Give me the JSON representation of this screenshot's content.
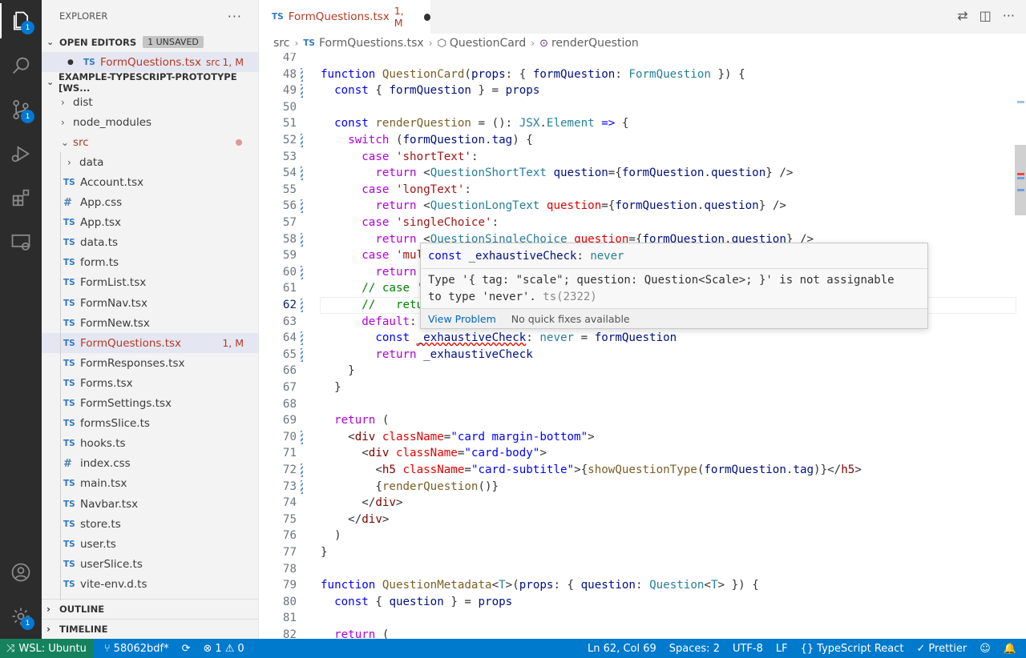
{
  "activity": {
    "explorer_badge": "1",
    "scm_badge": "1",
    "manage_badge": "1"
  },
  "sidebar": {
    "title": "EXPLORER",
    "more": "···",
    "open_editors": {
      "label": "OPEN EDITORS",
      "unsaved": "1 UNSAVED",
      "file": {
        "icon": "TS",
        "name": "FormQuestions.tsx",
        "dir": "src",
        "status": "1, M"
      }
    },
    "workspace": {
      "label": "EXAMPLE-TYPESCRIPT-PROTOTYPE [WS...",
      "items": [
        {
          "kind": "folder",
          "chev": "›",
          "name": "dist"
        },
        {
          "kind": "folder",
          "chev": "›",
          "name": "node_modules"
        },
        {
          "kind": "folder",
          "chev": "⌄",
          "name": "src"
        },
        {
          "kind": "folder",
          "chev": "›",
          "name": "data"
        },
        {
          "kind": "ts",
          "icon": "TS",
          "name": "Account.tsx"
        },
        {
          "kind": "css",
          "icon": "#",
          "name": "App.css"
        },
        {
          "kind": "ts",
          "icon": "TS",
          "name": "App.tsx"
        },
        {
          "kind": "ts",
          "icon": "TS",
          "name": "data.ts"
        },
        {
          "kind": "ts",
          "icon": "TS",
          "name": "form.ts"
        },
        {
          "kind": "ts",
          "icon": "TS",
          "name": "FormList.tsx"
        },
        {
          "kind": "ts",
          "icon": "TS",
          "name": "FormNav.tsx"
        },
        {
          "kind": "ts",
          "icon": "TS",
          "name": "FormNew.tsx"
        },
        {
          "kind": "ts",
          "icon": "TS",
          "name": "FormQuestions.tsx",
          "status": "1, M"
        },
        {
          "kind": "ts",
          "icon": "TS",
          "name": "FormResponses.tsx"
        },
        {
          "kind": "ts",
          "icon": "TS",
          "name": "Forms.tsx"
        },
        {
          "kind": "ts",
          "icon": "TS",
          "name": "FormSettings.tsx"
        },
        {
          "kind": "ts",
          "icon": "TS",
          "name": "formsSlice.ts"
        },
        {
          "kind": "ts",
          "icon": "TS",
          "name": "hooks.ts"
        },
        {
          "kind": "css",
          "icon": "#",
          "name": "index.css"
        },
        {
          "kind": "ts",
          "icon": "TS",
          "name": "main.tsx"
        },
        {
          "kind": "ts",
          "icon": "TS",
          "name": "Navbar.tsx"
        },
        {
          "kind": "ts",
          "icon": "TS",
          "name": "store.ts"
        },
        {
          "kind": "ts",
          "icon": "TS",
          "name": "user.ts"
        },
        {
          "kind": "ts",
          "icon": "TS",
          "name": "userSlice.ts"
        },
        {
          "kind": "ts",
          "icon": "TS",
          "name": "vite-env.d.ts"
        }
      ]
    },
    "outline": "OUTLINE",
    "timeline": "TIMELINE"
  },
  "tab": {
    "icon": "TS",
    "name": "FormQuestions.tsx",
    "status": "1, M"
  },
  "breadcrumb": {
    "folder": "src",
    "file_icon": "TS",
    "file": "FormQuestions.tsx",
    "component": "QuestionCard",
    "symbol": "renderQuestion"
  },
  "editor": {
    "current_line": 62,
    "lines": [
      {
        "n": "47"
      },
      {
        "n": "48"
      },
      {
        "n": "49"
      },
      {
        "n": "50"
      },
      {
        "n": "51"
      },
      {
        "n": "52"
      },
      {
        "n": "53"
      },
      {
        "n": "54"
      },
      {
        "n": "55"
      },
      {
        "n": "56"
      },
      {
        "n": "57"
      },
      {
        "n": "58"
      },
      {
        "n": "59"
      },
      {
        "n": "60"
      },
      {
        "n": "61"
      },
      {
        "n": "62"
      },
      {
        "n": "63"
      },
      {
        "n": "64"
      },
      {
        "n": "65"
      },
      {
        "n": "66"
      },
      {
        "n": "67"
      },
      {
        "n": "68"
      },
      {
        "n": "69"
      },
      {
        "n": "70"
      },
      {
        "n": "71"
      },
      {
        "n": "72"
      },
      {
        "n": "73"
      },
      {
        "n": "74"
      },
      {
        "n": "75"
      },
      {
        "n": "76"
      },
      {
        "n": "77"
      },
      {
        "n": "78"
      },
      {
        "n": "79"
      },
      {
        "n": "80"
      },
      {
        "n": "81"
      },
      {
        "n": "82"
      }
    ]
  },
  "hover": {
    "signature": "const _exhaustiveCheck: never",
    "message": "Type '{ tag: \"scale\"; question: Question<Scale>; }' is not assignable",
    "message2": "to type 'never'.",
    "code": "ts(2322)",
    "view_problem": "View Problem",
    "no_fixes": "No quick fixes available"
  },
  "status": {
    "remote": "WSL: Ubuntu",
    "branch": "58062bdf*",
    "errors": "1",
    "warnings": "0",
    "position": "Ln 62, Col 69",
    "spaces": "Spaces: 2",
    "encoding": "UTF-8",
    "eol": "LF",
    "language": "TypeScript React",
    "prettier": "Prettier"
  },
  "colors": {
    "accent": "#007acc",
    "remote": "#16825d",
    "modified": "#b43a22",
    "ts_icon": "#3178c6"
  }
}
